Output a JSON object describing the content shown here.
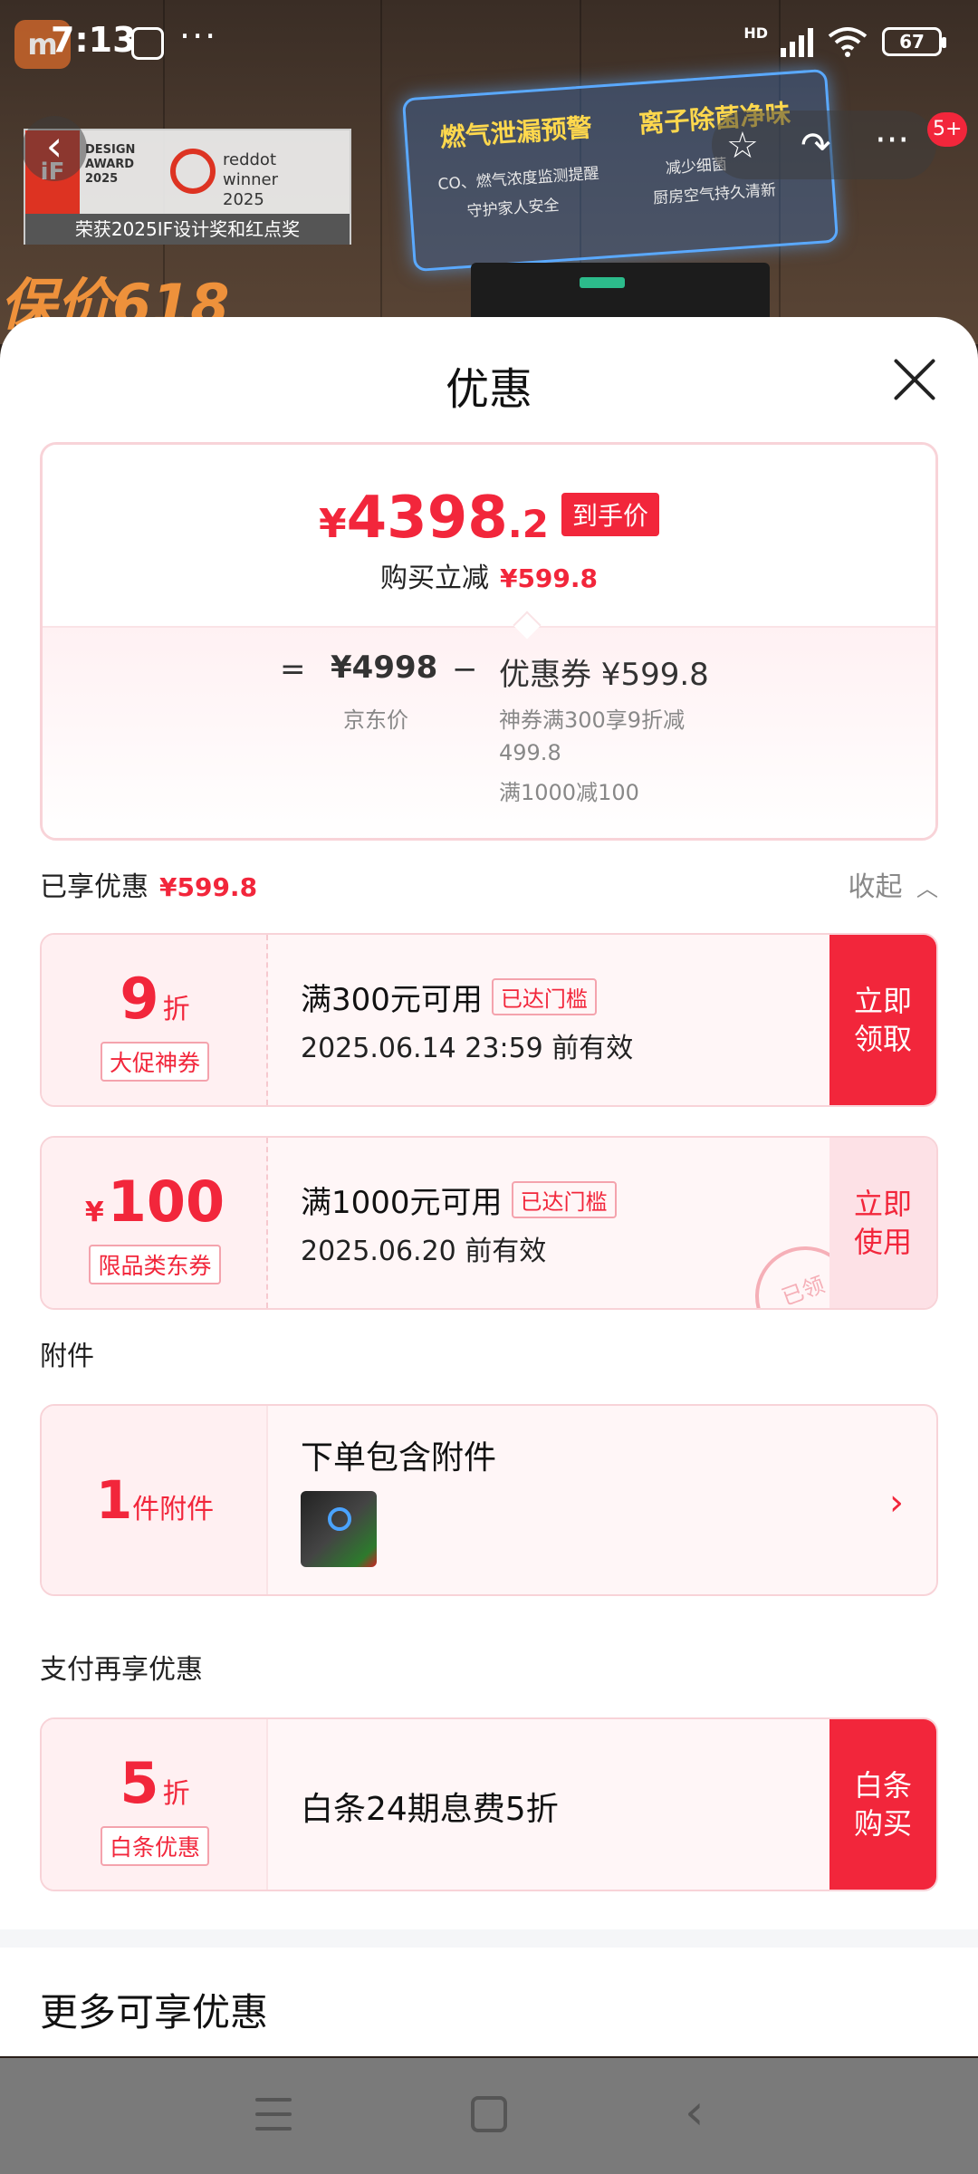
{
  "status_bar": {
    "time": "7:13",
    "network": "HD",
    "battery": "67",
    "more": "···"
  },
  "backdrop": {
    "award_badge_line1": "DESIGN AWARD 2025",
    "award_reddot": "reddot winner 2025",
    "award_caption": "荣获2025IF设计奖和红点奖",
    "feature1_title": "燃气泄漏预警",
    "feature1_line1": "CO、燃气浓度监测提醒",
    "feature1_line2": "守护家人安全",
    "feature2_title": "离子除菌净味",
    "feature2_line1": "减少细菌",
    "feature2_line2": "厨房空气持久清新",
    "banner_text": "保价618",
    "cart_badge": "5+"
  },
  "sheet": {
    "title": "优惠",
    "summary": {
      "currency": "¥",
      "price_int": "4398",
      "price_dec": ".2",
      "price_tag": "到手价",
      "reduce_label": "购买立减",
      "reduce_value": "¥599.8",
      "eq_sign": "=",
      "jd_price": "¥4998",
      "jd_label": "京东价",
      "minus_sign": "−",
      "coupon_total": "优惠券 ¥599.8",
      "coupon_detail1": "神券满300享9折减",
      "coupon_detail2": "499.8",
      "coupon_detail3": "满1000减100"
    },
    "enjoyed": {
      "label": "已享优惠",
      "value": "¥599.8",
      "collapse": "收起"
    },
    "coupons": [
      {
        "currency": "",
        "amount": "9",
        "unit": "折",
        "badge": "大促神券",
        "title": "满300元可用",
        "threshold": "已达门槛",
        "valid": "2025.06.14 23:59 前有效",
        "action": "立即领取"
      },
      {
        "currency": "¥",
        "amount": "100",
        "unit": "",
        "badge": "限品类东券",
        "title": "满1000元可用",
        "threshold": "已达门槛",
        "valid": "2025.06.20 前有效",
        "action": "立即使用",
        "stamp": "已领"
      }
    ],
    "accessories": {
      "section": "附件",
      "count": "1",
      "unit": "件附件",
      "title": "下单包含附件"
    },
    "payment": {
      "section": "支付再享优惠",
      "amount": "5",
      "unit": "折",
      "badge": "白条优惠",
      "title": "白条24期息费5折",
      "action": "白条购买"
    },
    "more_title": "更多可享优惠"
  },
  "colors": {
    "accent": "#f2263b",
    "light_pink": "#fff0f2"
  },
  "icons": {
    "close": "close-icon",
    "back": "back-arrow-icon",
    "star": "star-icon",
    "share": "share-icon",
    "chevron_up": "chevron-up-icon",
    "chevron_right": "chevron-right-icon"
  }
}
